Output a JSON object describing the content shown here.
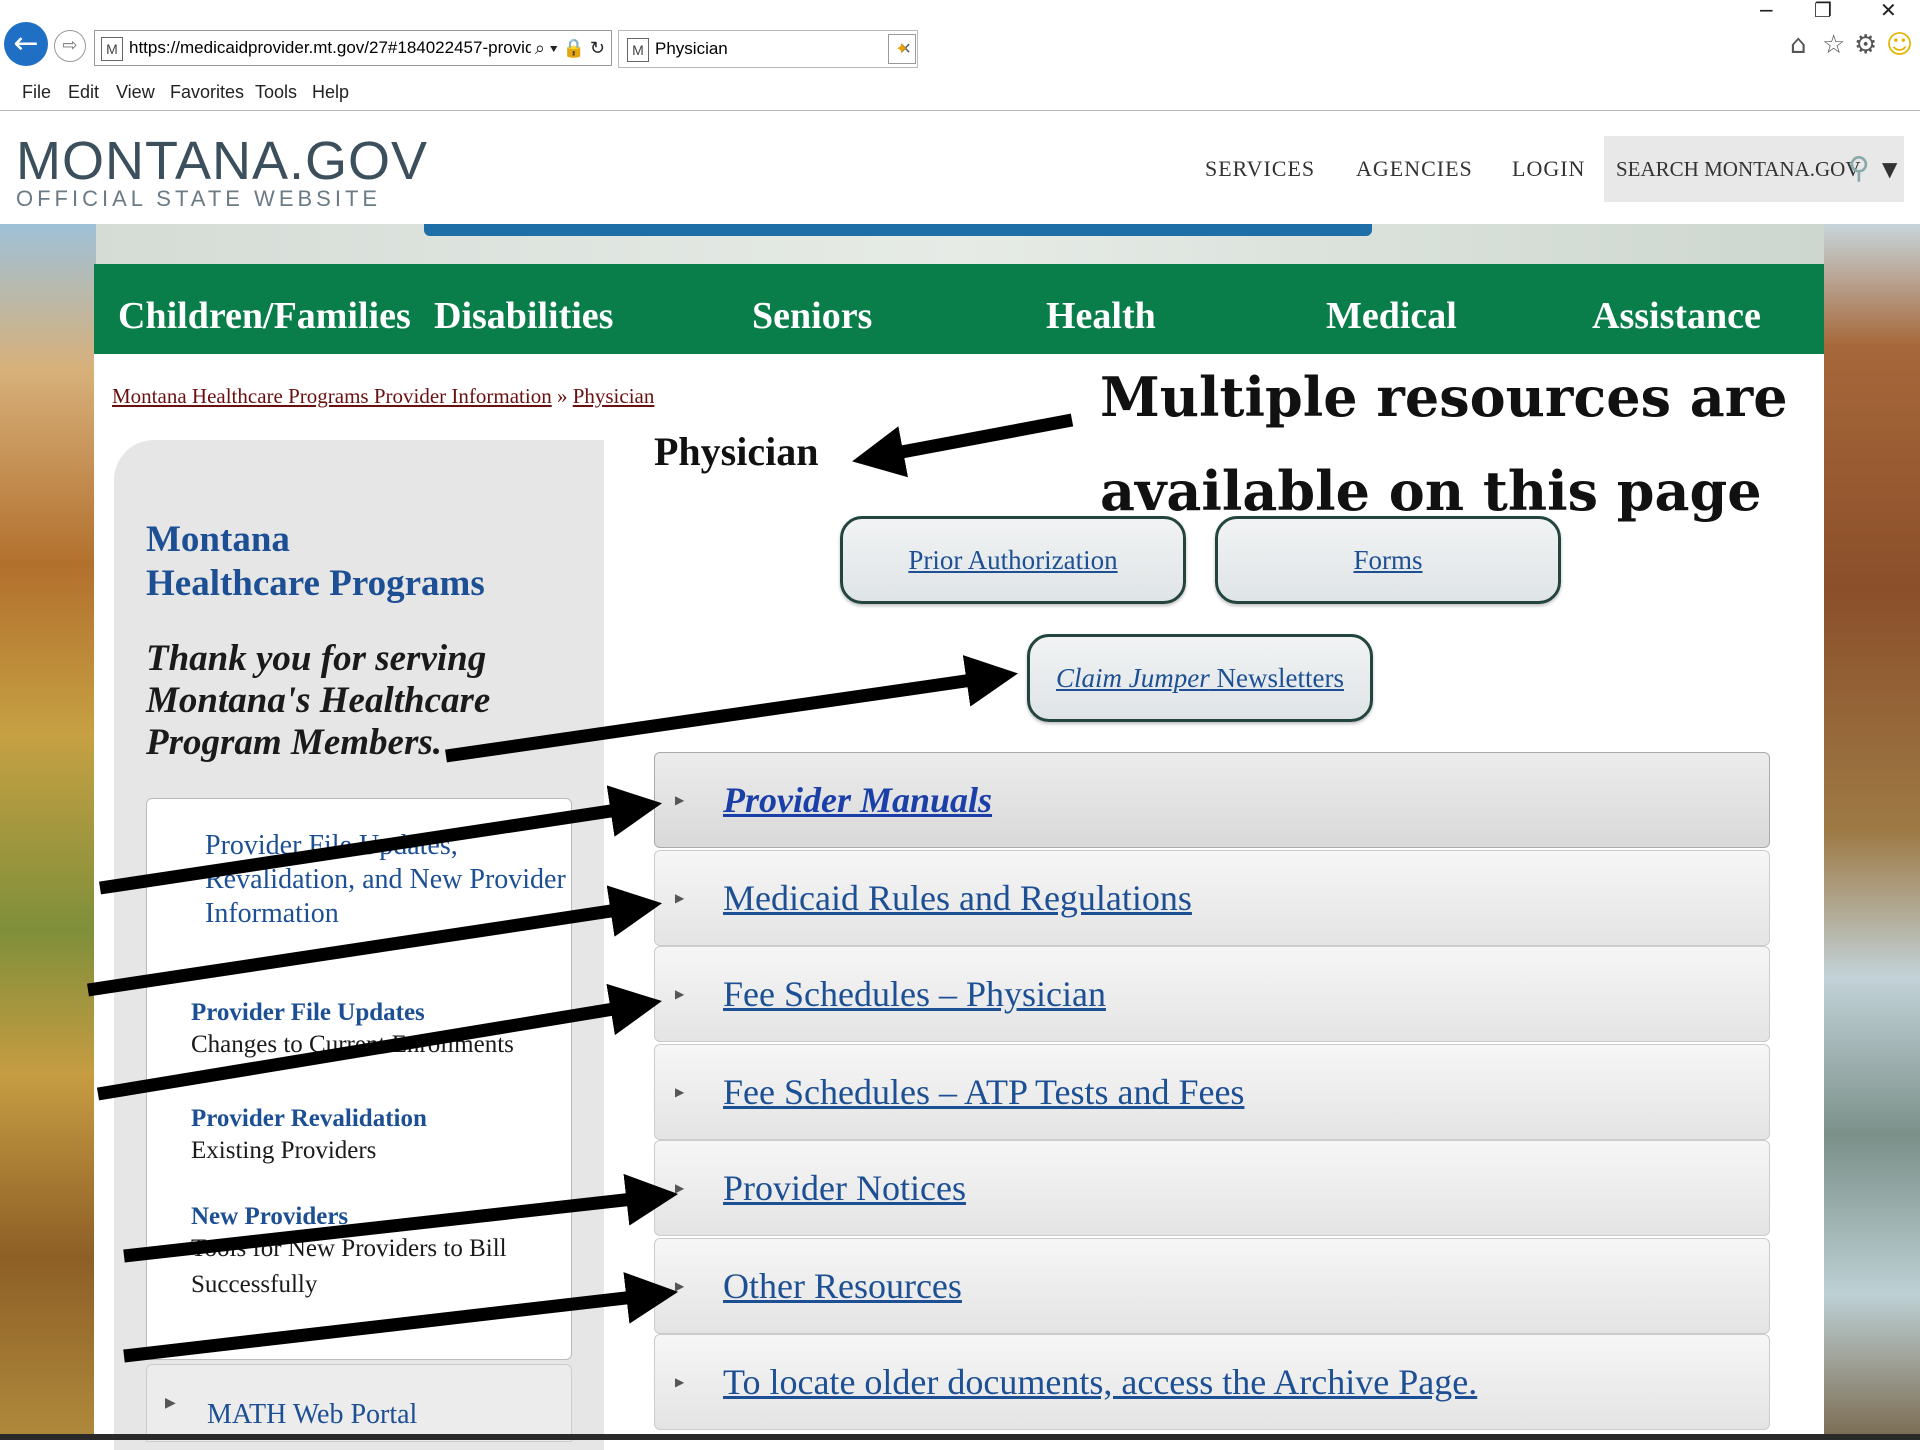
{
  "browser": {
    "url": "https://medicaidprovider.mt.gov/27#184022457-provid",
    "tab_title": "Physician",
    "favicon": "M",
    "menu": [
      "File",
      "Edit",
      "View",
      "Favorites",
      "Tools",
      "Help"
    ]
  },
  "site_header": {
    "logo": "MONTANA.GOV",
    "logo_sub": "OFFICIAL STATE WEBSITE",
    "nav": [
      "SERVICES",
      "AGENCIES",
      "LOGIN"
    ],
    "search_label": "SEARCH MONTANA.GOV"
  },
  "topnav": [
    "Children/Families",
    "Disabilities",
    "Seniors",
    "Health",
    "Medical",
    "Assistance"
  ],
  "breadcrumb": {
    "parent": "Montana Healthcare Programs Provider Information",
    "separator": "»",
    "current": "Physician"
  },
  "page_title": "Physician",
  "sidebar": {
    "title_line1": "Montana",
    "title_line2": "Healthcare Programs",
    "thanks_line1": "Thank you for serving",
    "thanks_line2": "Montana's Healthcare",
    "thanks_line3": "Program Members.",
    "intro_link_line1": "Provider File Updates,",
    "intro_link_line2": "Revalidation, and New Provider",
    "intro_link_line3": "Information",
    "sections": [
      {
        "heading": "Provider File Updates",
        "text": "Changes to Current Enrollments"
      },
      {
        "heading": "Provider Revalidation",
        "text": "Existing Providers"
      },
      {
        "heading": "New Providers",
        "text_line1": "Tools for New Providers to Bill",
        "text_line2": "Successfully"
      }
    ],
    "math_portal": "MATH Web Portal"
  },
  "buttons": {
    "prior_auth": "Prior Authorization",
    "forms": "Forms",
    "claim_jumper_italic": "Claim Jumper",
    "claim_jumper_rest": " Newsletters"
  },
  "accordion": [
    "Provider Manuals",
    "Medicaid Rules and Regulations",
    "Fee Schedules – Physician",
    "Fee Schedules – ATP Tests and Fees",
    "Provider Notices",
    "Other Resources",
    "To locate older documents, access the Archive Page."
  ],
  "callout": {
    "line1": "Multiple resources are",
    "line2": "available on this page"
  },
  "colors": {
    "green_nav": "#0a7e4a",
    "link_blue": "#1c4f93",
    "breadcrumb": "#6b1010"
  }
}
